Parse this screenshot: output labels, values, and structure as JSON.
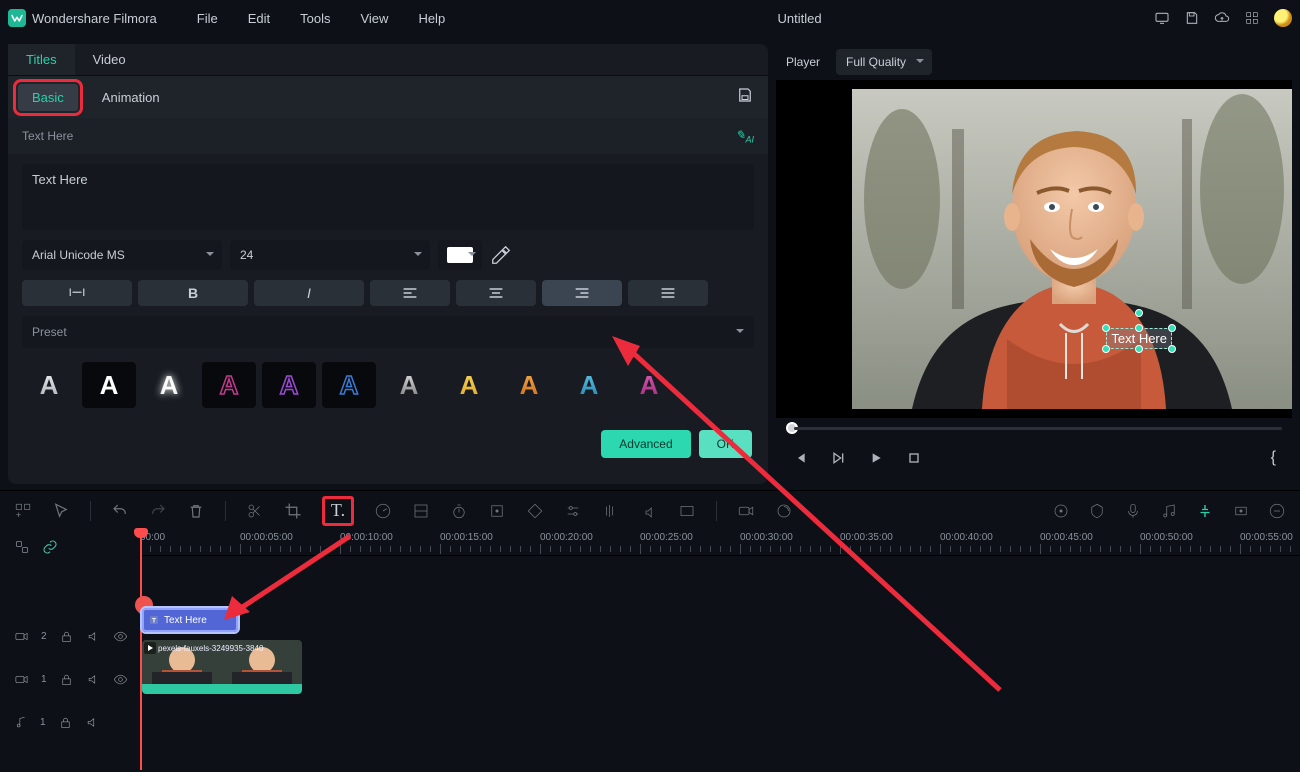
{
  "app": {
    "name": "Wondershare Filmora",
    "title": "Untitled"
  },
  "menu": [
    "File",
    "Edit",
    "Tools",
    "View",
    "Help"
  ],
  "tabs": {
    "titles": "Titles",
    "video": "Video",
    "active": "titles"
  },
  "subtabs": {
    "basic": "Basic",
    "animation": "Animation",
    "active": "basic"
  },
  "text_label": "Text Here",
  "text_value": "Text Here",
  "font": {
    "family": "Arial Unicode MS",
    "size": "24",
    "color": "#FFFFFF"
  },
  "format": {
    "spacing": "",
    "bold": "B",
    "italic": "I"
  },
  "preset_label": "Preset",
  "presets": [
    {
      "fg": "#ffffff",
      "grad": "linear-gradient(180deg,#fff,#9aa0a8)"
    },
    {
      "fg": "#ffffff",
      "grad": "none"
    },
    {
      "fg": "#ffffff",
      "grad": "radial-gradient(circle,#fff,#bdbdbd)",
      "glow": "0 0 8px #fff"
    },
    {
      "fg": "#c33b8e",
      "grad": "none",
      "stroke": "#c33b8e"
    },
    {
      "fg": "#9b4bd4",
      "grad": "none",
      "stroke": "#9b4bd4"
    },
    {
      "fg": "#3a7bd5",
      "grad": "none",
      "stroke": "#3a7bd5"
    },
    {
      "fg": "#ffffff",
      "grad": "linear-gradient(180deg,#fff,#5d5d5d)"
    },
    {
      "fg": "#f7c12a",
      "grad": "linear-gradient(180deg,#ffe26c,#d99b18)"
    },
    {
      "fg": "#f08a24",
      "grad": "linear-gradient(180deg,#ffb95a,#c45f0e)"
    },
    {
      "fg": "#2bb5e4",
      "grad": "linear-gradient(180deg,#6fd6f4,#1573a0)"
    },
    {
      "fg": "#d23a9a",
      "grad": "linear-gradient(180deg,#f06ac6,#8f1d6a)"
    }
  ],
  "buttons": {
    "advanced": "Advanced",
    "ok": "OK"
  },
  "player": {
    "label": "Player",
    "quality": "Full Quality",
    "overlay_text": "Text Here"
  },
  "timeline": {
    "labels": [
      "00:00",
      "00:00:05:00",
      "00:00:10:00",
      "00:00:15:00",
      "00:00:20:00",
      "00:00:25:00",
      "00:00:30:00",
      "00:00:35:00",
      "00:00:40:00",
      "00:00:45:00",
      "00:00:50:00",
      "00:00:55:00"
    ],
    "spacing": 100,
    "text_clip_label": "Text Here",
    "video_clip_label": "pexels-fauxels-3249935-3840",
    "tracks": {
      "cam": "2",
      "vid": "1",
      "audio": "1"
    }
  }
}
